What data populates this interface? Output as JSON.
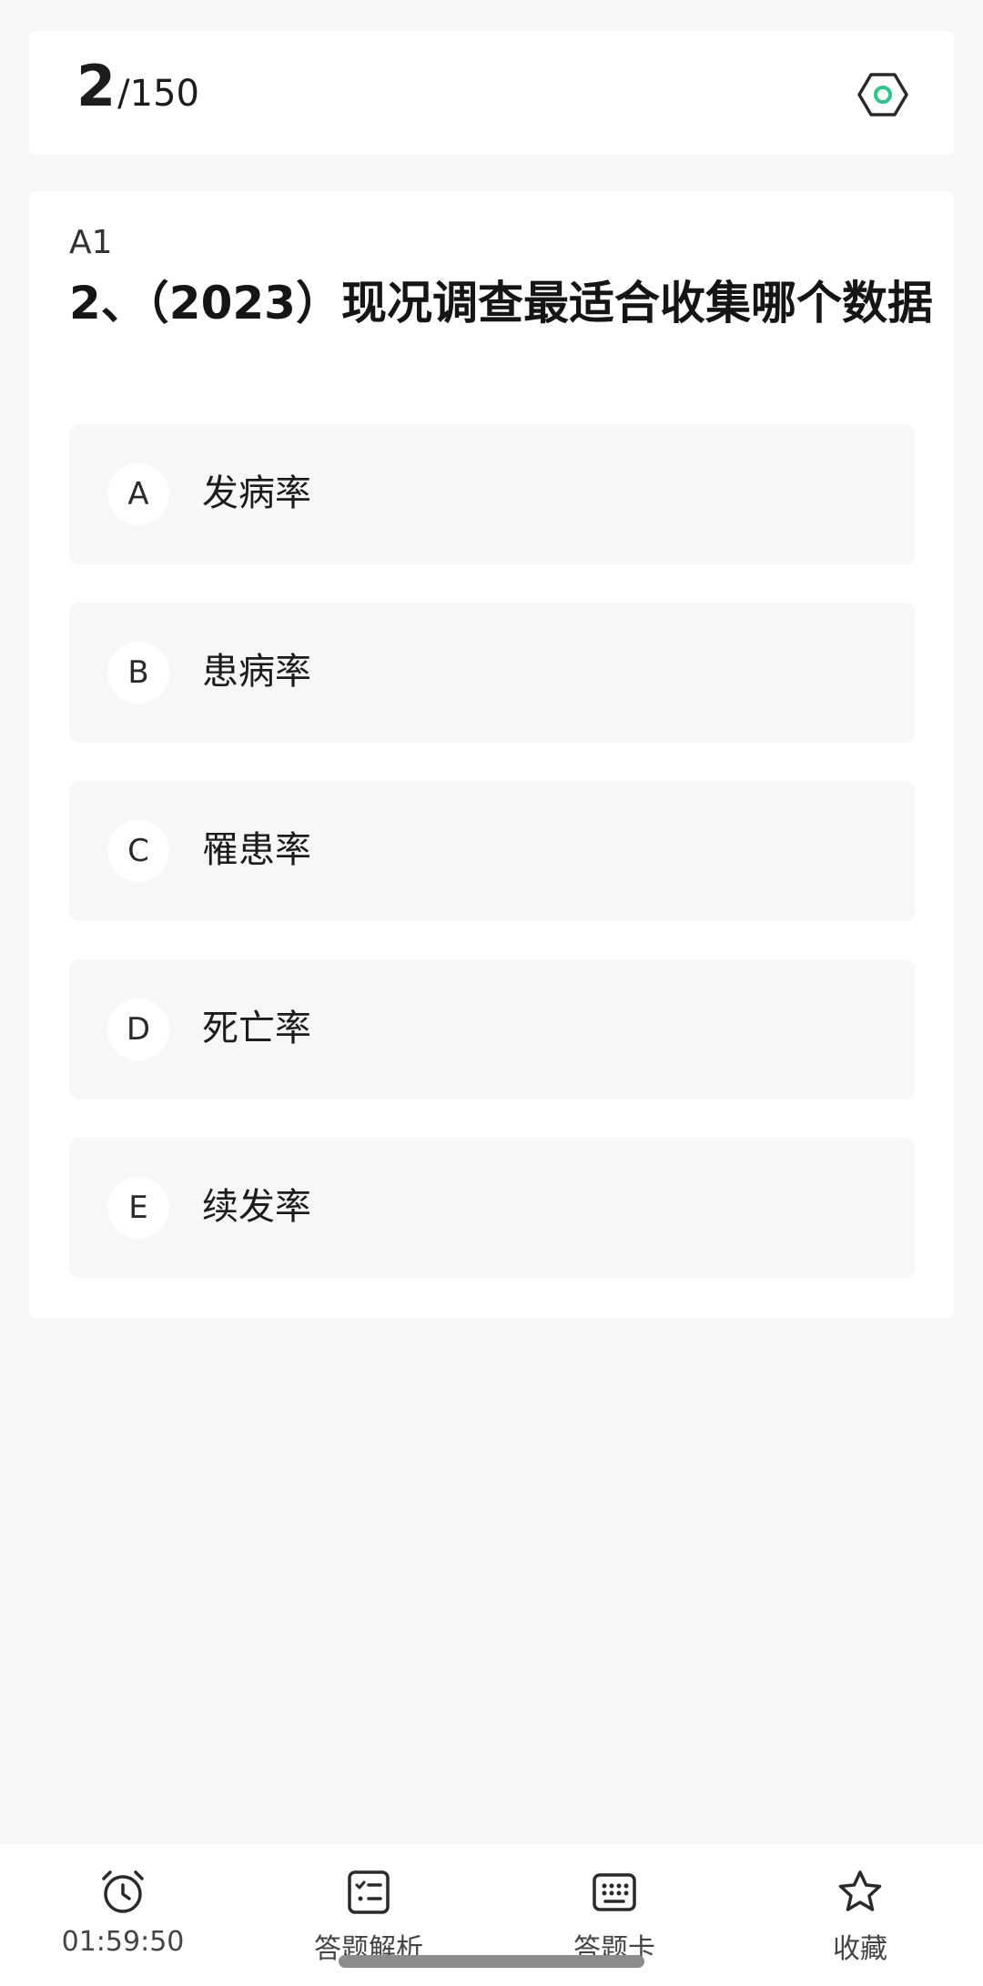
{
  "header": {
    "current": "2",
    "total": "/150"
  },
  "question": {
    "type": "A1",
    "text": "2、（2023）现况调查最适合收集哪个数据",
    "options": [
      {
        "letter": "A",
        "text": "发病率"
      },
      {
        "letter": "B",
        "text": "患病率"
      },
      {
        "letter": "C",
        "text": "罹患率"
      },
      {
        "letter": "D",
        "text": "死亡率"
      },
      {
        "letter": "E",
        "text": "续发率"
      }
    ]
  },
  "bottom_bar": {
    "timer": "01:59:50",
    "analysis": "答题解析",
    "answer_card": "答题卡",
    "favorite": "收藏"
  },
  "colors": {
    "accent": "#2cc48a",
    "background": "#f6f7f9",
    "card": "#ffffff"
  },
  "icons": [
    "settings-icon",
    "alarm-clock-icon",
    "checklist-icon",
    "keyboard-grid-icon",
    "star-icon"
  ]
}
